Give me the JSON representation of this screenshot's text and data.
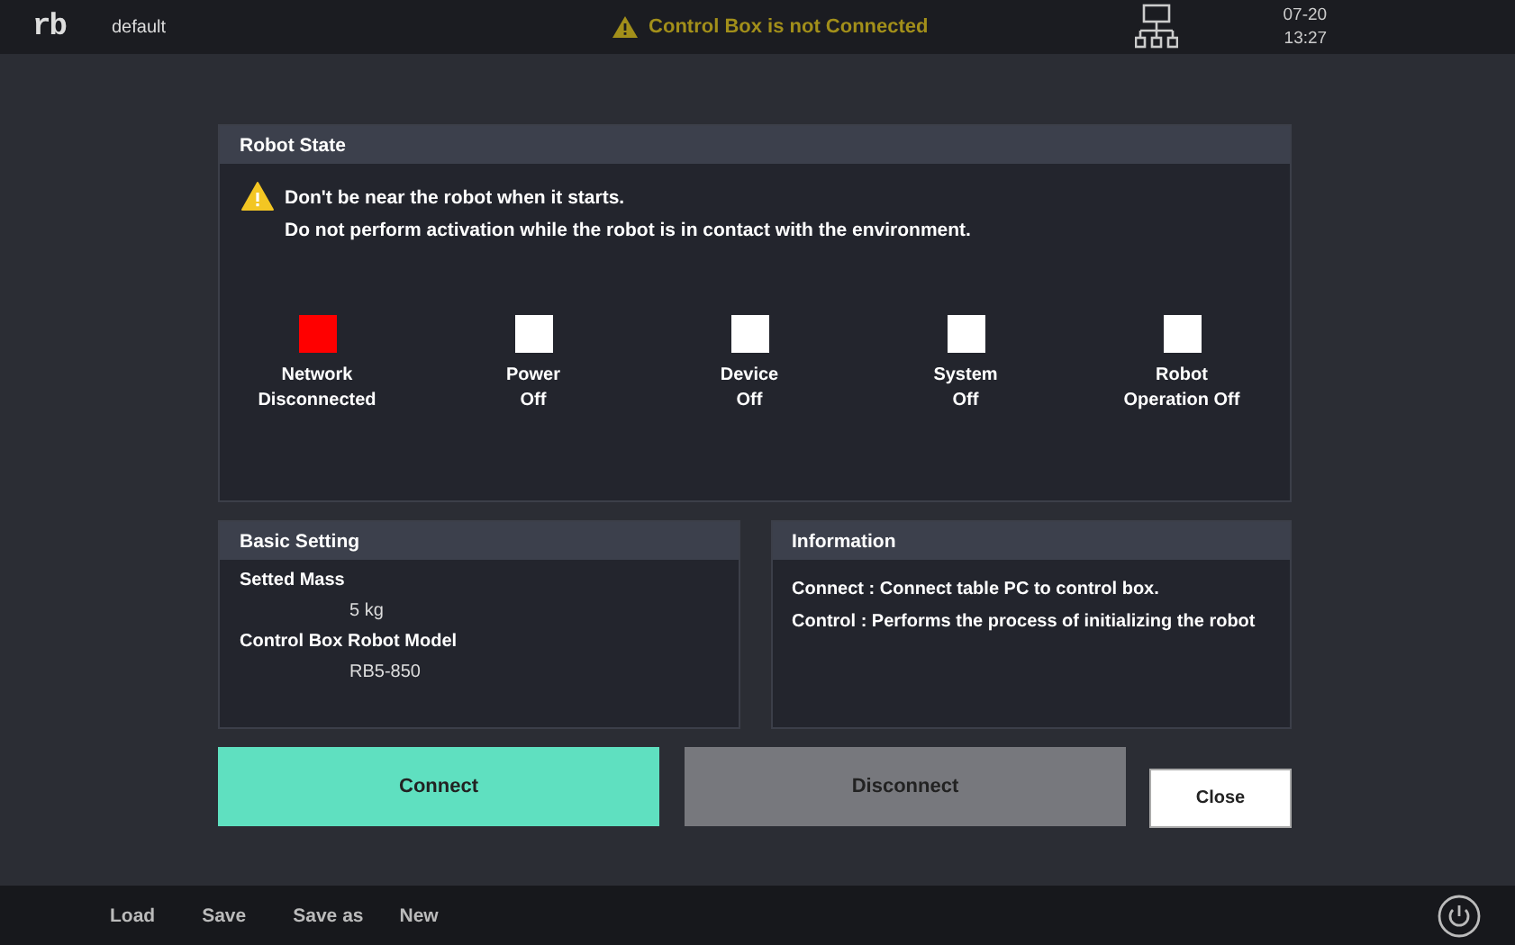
{
  "top_bar": {
    "logo": "rb",
    "project": "default",
    "alert": "Control Box is not Connected",
    "date": "07-20",
    "time": "13:27"
  },
  "robot_state": {
    "title": "Robot State",
    "warnings": [
      "Don't be near the robot when it starts.",
      "Do not perform activation while the robot is in contact with the environment."
    ],
    "indicators": [
      {
        "label": "Network\nDisconnected",
        "color": "#ff0000"
      },
      {
        "label": "Power\nOff",
        "color": "#ffffff"
      },
      {
        "label": "Device\nOff",
        "color": "#ffffff"
      },
      {
        "label": "System\nOff",
        "color": "#ffffff"
      },
      {
        "label": "Robot\nOperation Off",
        "color": "#ffffff"
      }
    ]
  },
  "basic_setting": {
    "title": "Basic Setting",
    "fields": [
      {
        "label": "Setted Mass",
        "value": "5 kg"
      },
      {
        "label": "Control Box Robot Model",
        "value": "RB5-850"
      }
    ]
  },
  "information": {
    "title": "Information",
    "lines": [
      "Connect : Connect table PC to control box.",
      "Control : Performs the process of initializing the robot"
    ]
  },
  "buttons": [
    {
      "label": "Connect",
      "kind": "primary"
    },
    {
      "label": "Disconnect",
      "kind": "secondary"
    },
    {
      "label": "Close",
      "kind": "plain"
    }
  ],
  "bottom_bar": {
    "items": [
      "Load",
      "Save",
      "Save as",
      "New"
    ]
  }
}
